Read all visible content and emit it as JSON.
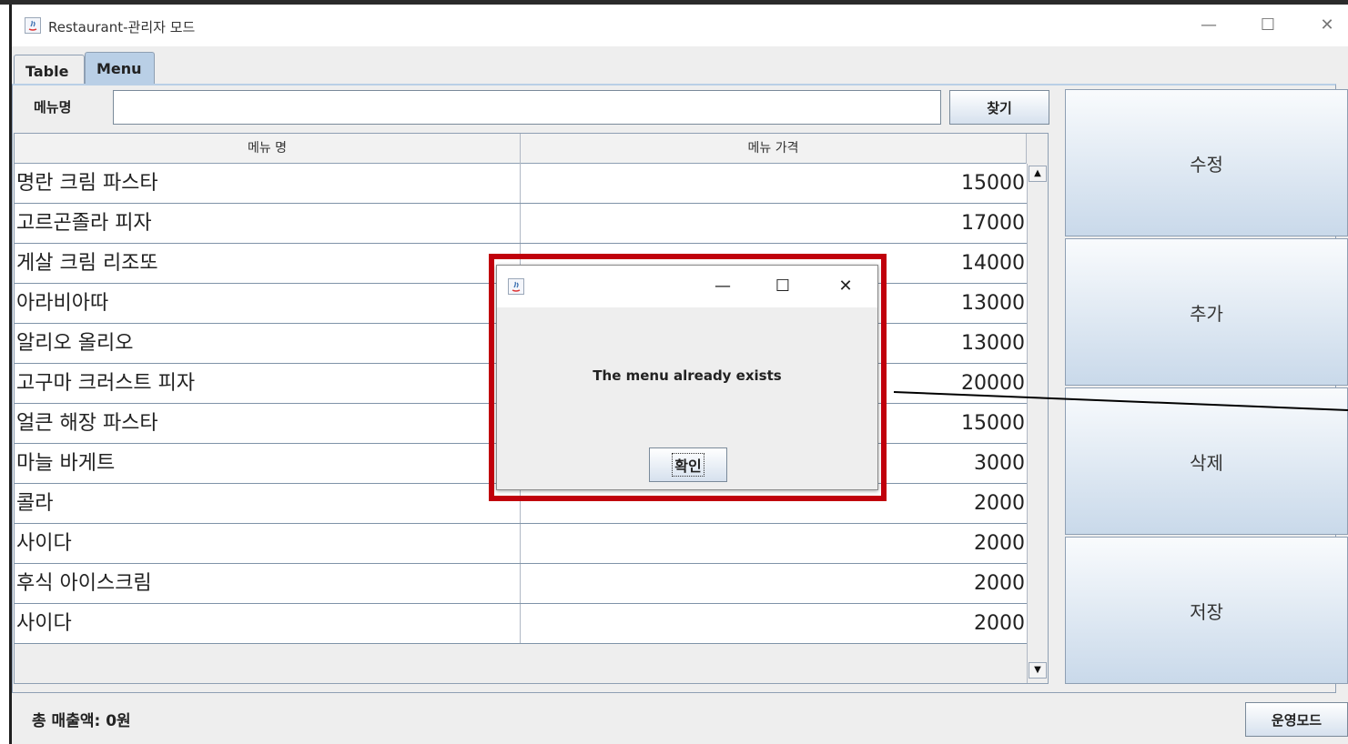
{
  "window": {
    "title": "Restaurant-관리자 모드",
    "controls": [
      "—",
      "☐",
      "✕"
    ]
  },
  "tabs": [
    {
      "label": "Table",
      "active": false
    },
    {
      "label": "Menu",
      "active": true
    }
  ],
  "search": {
    "label": "메뉴명",
    "value": "",
    "button": "찾기"
  },
  "table": {
    "columns": [
      "메뉴 명",
      "메뉴 가격"
    ],
    "rows": [
      [
        "명란 크림 파스타",
        "15000"
      ],
      [
        "고르곤졸라 피자",
        "17000"
      ],
      [
        "게살 크림 리조또",
        "14000"
      ],
      [
        "아라비아따",
        "13000"
      ],
      [
        "알리오 올리오",
        "13000"
      ],
      [
        "고구마 크러스트 피자",
        "20000"
      ],
      [
        "얼큰 해장 파스타",
        "15000"
      ],
      [
        "마늘 바게트",
        "3000"
      ],
      [
        "콜라",
        "2000"
      ],
      [
        "사이다",
        "2000"
      ],
      [
        "후식 아이스크림",
        "2000"
      ],
      [
        "사이다",
        "2000"
      ]
    ]
  },
  "side_buttons": [
    "수정",
    "추가",
    "삭제",
    "저장"
  ],
  "footer": {
    "sales": "총 매출액: 0원",
    "mode_button": "운영모드"
  },
  "dialog": {
    "message": "The menu already exists",
    "ok": "확인"
  },
  "colors": {
    "highlight": "#c0000c",
    "tab_active": "#b9cfe6"
  }
}
